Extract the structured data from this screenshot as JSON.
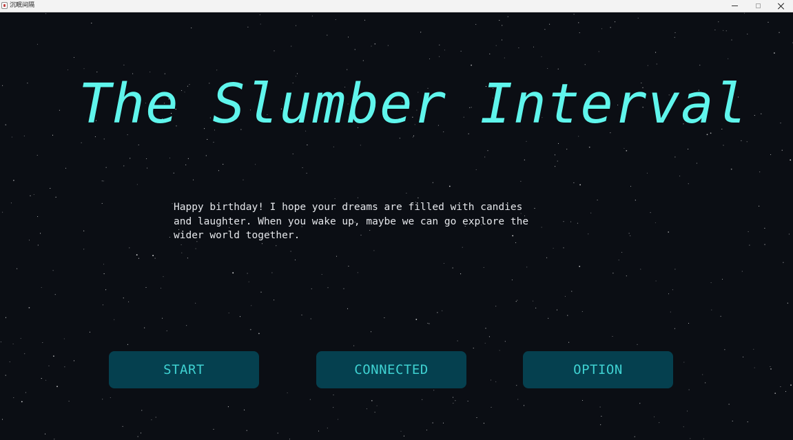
{
  "window": {
    "title": "沉眠间隔"
  },
  "game": {
    "title": "The Slumber Interval",
    "greeting": "Happy birthday! I hope your dreams are filled with candies\nand laughter. When you wake up, maybe we can go explore the\nwider world together."
  },
  "menu": {
    "start_label": "START",
    "connected_label": "CONNECTED",
    "option_label": "OPTION"
  },
  "icons": {
    "app": "app-icon",
    "minimize": "minimize-icon",
    "maximize": "maximize-icon",
    "close": "close-icon"
  },
  "colors": {
    "background": "#0b0e14",
    "title": "#5ff5ec",
    "text": "#e6e8ec",
    "button_bg": "#05404f",
    "button_text": "#3fd2d2"
  }
}
